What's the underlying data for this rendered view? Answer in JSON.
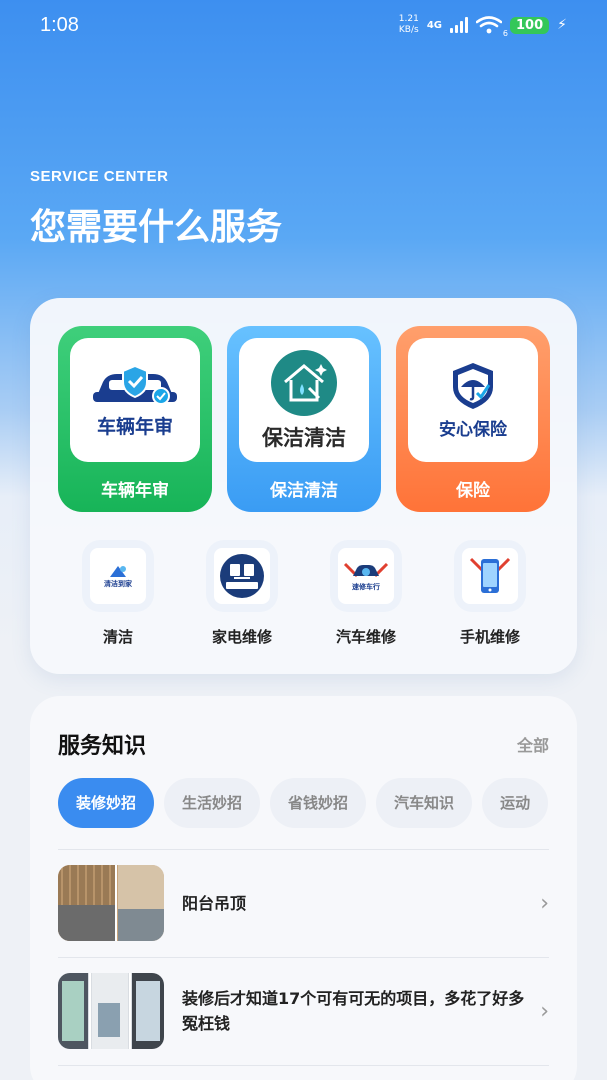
{
  "status": {
    "time": "1:08",
    "speed_value": "1.21",
    "speed_unit": "KB/s",
    "network": "4G",
    "wifi_level": "6",
    "battery": "100"
  },
  "hero": {
    "subtitle": "SERVICE CENTER",
    "title": "您需要什么服务"
  },
  "main_services": [
    {
      "label": "车辆年审",
      "inner": "车辆年审",
      "color": "#22bb5f"
    },
    {
      "label": "保洁清洁",
      "inner": "保洁清洁",
      "color": "#4aa6f7"
    },
    {
      "label": "保险",
      "inner": "安心保险",
      "color": "#ff7d45"
    }
  ],
  "sub_services": [
    {
      "label": "清洁",
      "icon_text": "清洁到家"
    },
    {
      "label": "家电维修",
      "icon_text": "家电维修"
    },
    {
      "label": "汽车维修",
      "icon_text": "速修车行"
    },
    {
      "label": "手机维修",
      "icon_text": "手机维修"
    }
  ],
  "knowledge": {
    "title": "服务知识",
    "all_label": "全部",
    "tabs": [
      "装修妙招",
      "生活妙招",
      "省钱妙招",
      "汽车知识",
      "运动"
    ],
    "articles": [
      {
        "title": "阳台吊顶"
      },
      {
        "title": "装修后才知道17个可有可无的项目，多花了好多冤枉钱"
      }
    ]
  }
}
